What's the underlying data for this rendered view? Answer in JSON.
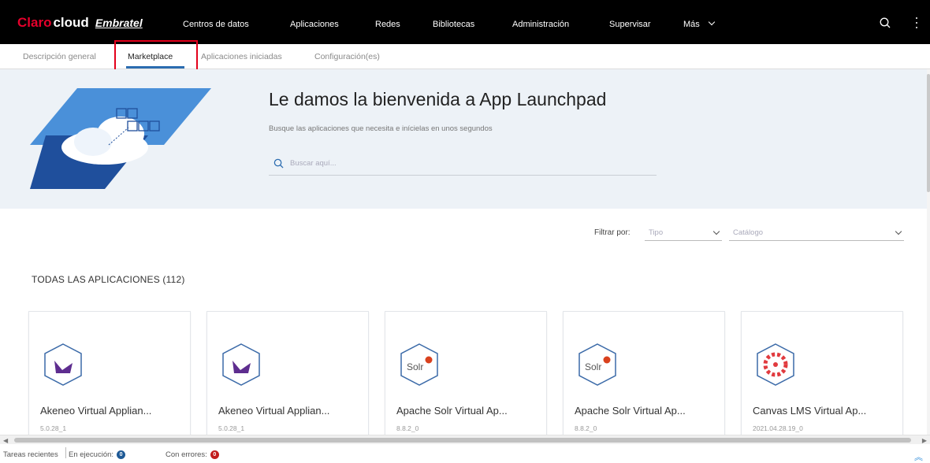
{
  "brand": {
    "claro": "Claro",
    "cloud": "cloud",
    "embratel": "Embratel"
  },
  "topnav": {
    "items": [
      "Centros de datos",
      "Aplicaciones",
      "Redes",
      "Bibliotecas",
      "Administración",
      "Supervisar",
      "Más"
    ]
  },
  "subnav": {
    "tabs": [
      "Descripción general",
      "Marketplace",
      "Aplicaciones iniciadas",
      "Configuración(es)"
    ],
    "active": "Marketplace"
  },
  "hero": {
    "title": "Le damos la bienvenida a App Launchpad",
    "subtitle": "Busque las aplicaciones que necesita e inícielas en unos segundos",
    "search_placeholder": "Buscar aquí..."
  },
  "filters": {
    "label": "Filtrar por:",
    "type_placeholder": "Tipo",
    "catalog_placeholder": "Catálogo"
  },
  "section": {
    "title": "TODAS LAS APLICACIONES (112)"
  },
  "apps": [
    {
      "name": "Akeneo Virtual Applian...",
      "version": "5.0.28_1",
      "icon": "akeneo-icon"
    },
    {
      "name": "Akeneo Virtual Applian...",
      "version": "5.0.28_1",
      "icon": "akeneo-icon"
    },
    {
      "name": "Apache Solr Virtual Ap...",
      "version": "8.8.2_0",
      "icon": "solr-icon"
    },
    {
      "name": "Apache Solr Virtual Ap...",
      "version": "8.8.2_0",
      "icon": "solr-icon"
    },
    {
      "name": "Canvas LMS Virtual Ap...",
      "version": "2021.04.28.19_0",
      "icon": "canvas-icon"
    }
  ],
  "status": {
    "recent_tasks": "Tareas recientes",
    "running_label": "En ejecución:",
    "running_count": "0",
    "errors_label": "Con errores:",
    "errors_count": "0"
  },
  "colors": {
    "accent": "#2b6cb0",
    "brand_red": "#e4002b",
    "highlight": "#e3001b",
    "hero_bg": "#edf2f7"
  }
}
